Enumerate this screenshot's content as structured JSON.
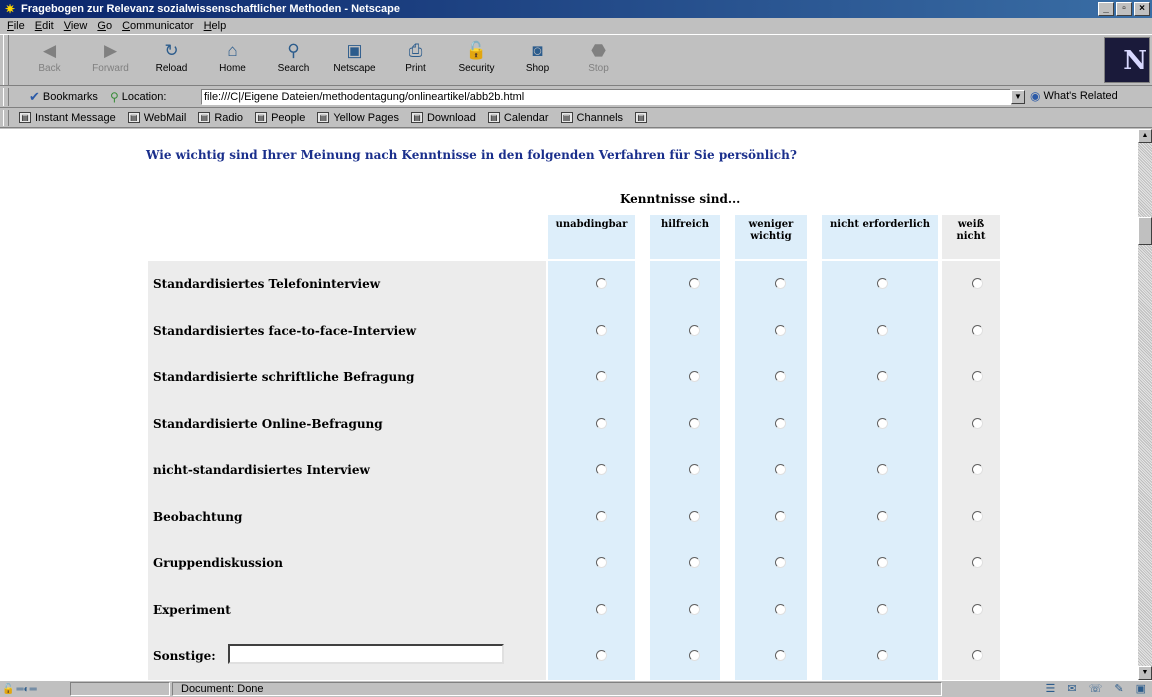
{
  "window": {
    "title": "Fragebogen zur Relevanz sozialwissenschaftlicher Methoden - Netscape"
  },
  "menu": [
    "File",
    "Edit",
    "View",
    "Go",
    "Communicator",
    "Help"
  ],
  "nav": [
    {
      "label": "Back",
      "icon": "back-arrow-icon",
      "glyph": "◀",
      "disabled": true
    },
    {
      "label": "Forward",
      "icon": "forward-arrow-icon",
      "glyph": "▶",
      "disabled": true
    },
    {
      "label": "Reload",
      "icon": "reload-icon",
      "glyph": "↻",
      "disabled": false
    },
    {
      "label": "Home",
      "icon": "home-icon",
      "glyph": "⌂",
      "disabled": false
    },
    {
      "label": "Search",
      "icon": "search-icon",
      "glyph": "⚲",
      "disabled": false
    },
    {
      "label": "Netscape",
      "icon": "netscape-icon",
      "glyph": "▣",
      "disabled": false
    },
    {
      "label": "Print",
      "icon": "print-icon",
      "glyph": "⎙",
      "disabled": false
    },
    {
      "label": "Security",
      "icon": "lock-icon",
      "glyph": "🔓",
      "disabled": false
    },
    {
      "label": "Shop",
      "icon": "shop-icon",
      "glyph": "◙",
      "disabled": false
    },
    {
      "label": "Stop",
      "icon": "stop-icon",
      "glyph": "⬣",
      "disabled": true
    }
  ],
  "location": {
    "bookmarks_label": "Bookmarks",
    "location_label": "Location:",
    "url": "file:///C|/Eigene Dateien/methodentagung/onlineartikel/abb2b.html",
    "related_label": "What's Related"
  },
  "personal": [
    "Instant Message",
    "WebMail",
    "Radio",
    "People",
    "Yellow Pages",
    "Download",
    "Calendar",
    "Channels",
    ""
  ],
  "page": {
    "question": "Wie wichtig sind Ihrer Meinung nach Kenntnisse in den folgenden Verfahren für Sie persönlich?",
    "group_label": "Kenntnisse sind...",
    "columns": [
      "unabdingbar",
      "hilfreich",
      "weniger wichtig",
      "nicht erforderlich",
      "weiß nicht"
    ],
    "rows": [
      "Standardisiertes Telefoninterview",
      "Standardisiertes face-to-face-Interview",
      "Standardisierte schriftliche Befragung",
      "Standardisierte Online-Befragung",
      "nicht-standardisiertes Interview",
      "Beobachtung",
      "Gruppendiskussion",
      "Experiment",
      "Sonstige:"
    ],
    "other_value": ""
  },
  "status": {
    "text": "Document: Done"
  }
}
